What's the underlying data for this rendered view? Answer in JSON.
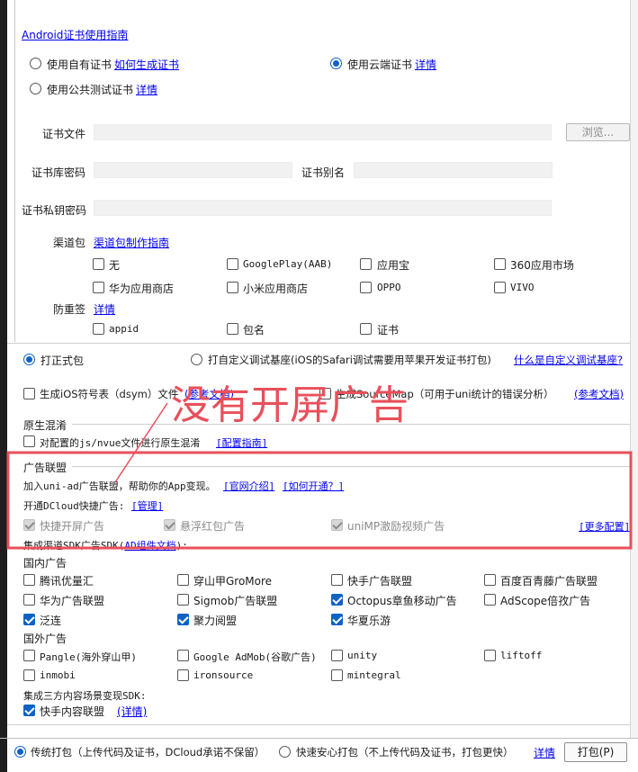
{
  "cert": {
    "android_guide": "Android证书使用指南",
    "own_cert": "使用自有证书",
    "own_cert_link": "如何生成证书",
    "cloud_cert": "使用云端证书",
    "cloud_cert_link": "详情",
    "public_cert": "使用公共测试证书",
    "public_cert_link": "详情",
    "file_label": "证书文件",
    "browse_button": "浏览...",
    "keystore_pwd_label": "证书库密码",
    "alias_label": "证书别名",
    "key_pwd_label": "证书私钥密码"
  },
  "channel": {
    "label": "渠道包",
    "guide_link": "渠道包制作指南",
    "options": [
      "无",
      "GooglePlay(AAB)",
      "应用宝",
      "360应用市场",
      "华为应用商店",
      "小米应用商店",
      "OPPO",
      "VIVO"
    ]
  },
  "antiresign": {
    "label": "防重签",
    "link": "详情",
    "options": [
      "appid",
      "包名",
      "证书"
    ]
  },
  "build": {
    "formal": "打正式包",
    "custom_base": "打自定义调试基座(iOS的Safari调试需要用苹果开发证书打包)",
    "custom_base_link": "什么是自定义调试基座?",
    "dsym": "生成iOS符号表（dsym）文件",
    "dsym_link": "(参考文档)",
    "sourcemap": "生成SourceMap（可用于uni统计的错误分析）",
    "sourcemap_link": "(参考文档)"
  },
  "obfuscation": {
    "title": "原生混淆",
    "checkbox": "对配置的js/nvue文件进行原生混淆",
    "link": "[配置指南]"
  },
  "ads": {
    "title": "广告联盟",
    "intro": "加入uni-ad广告联盟，帮助你的App变现。",
    "intro_link_1": "[官网介绍]",
    "intro_link_2": "[如何开通？]",
    "dcloud_label": "开通DCloud快捷广告:",
    "dcloud_link": "[管理]",
    "quick_splash": "快捷开屏广告",
    "float_red": "悬浮红包广告",
    "unimp_video": "uniMP激励视频广告",
    "more_config": "[更多配置]",
    "sdk_label": "集成渠道SDK广告SDK(",
    "sdk_link": "AD组件文档",
    "sdk_label_end": "):",
    "domestic_label": "国内广告",
    "domestic": [
      "腾讯优量汇",
      "穿山甲GroMore",
      "快手广告联盟",
      "百度百青藤广告联盟",
      "华为广告联盟",
      "Sigmob广告联盟",
      "Octopus章鱼移动广告",
      "AdScope倍孜广告",
      "泛连",
      "聚力阅盟",
      "华夏乐游"
    ],
    "foreign_label": "国外广告",
    "foreign": [
      "Pangle(海外穿山甲)",
      "Google AdMob(谷歌广告)",
      "unity",
      "liftoff",
      "inmobi",
      "ironsource",
      "mintegral"
    ],
    "content_label": "集成三方内容场景变现SDK:",
    "kuaishou_content": "快手内容联盟",
    "kuaishou_link": "(详情)"
  },
  "annotation": {
    "text": "没有开屏广告",
    "color": "#e8505b"
  },
  "footer": {
    "traditional": "传统打包（上传代码及证书，DCloud承诺不保留）",
    "fast": "快速安心打包（不上传代码及证书，打包更快）",
    "detail_link": "详情",
    "pack_button": "打包(P)"
  },
  "colors": {
    "accent": "#0f62c4",
    "link": "#0000ee",
    "annotation": "#e8505b"
  }
}
